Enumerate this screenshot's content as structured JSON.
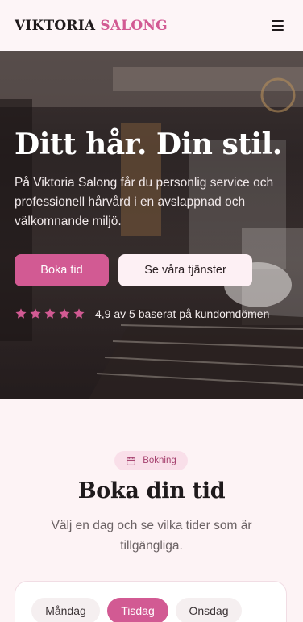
{
  "header": {
    "logo_part1": "VIKTORIA",
    "logo_part2": "SALONG",
    "menu_icon": "hamburger-menu-icon"
  },
  "hero": {
    "title": "Ditt hår. Din stil.",
    "text": "På Viktoria Salong får du personlig service och professionell hårvård i en avslappnad och välkomnande miljö.",
    "primary_button": "Boka tid",
    "secondary_button": "Se våra tjänster",
    "rating": {
      "stars": 5,
      "max": 5,
      "text": "4,9 av 5 baserat på kundomdömen"
    }
  },
  "booking": {
    "badge": "Bokning",
    "badge_icon": "calendar-icon",
    "title": "Boka din tid",
    "subtitle": "Välj en dag och se vilka tider som är tillgängliga.",
    "days": [
      {
        "label": "Måndag",
        "active": false
      },
      {
        "label": "Tisdag",
        "active": true
      },
      {
        "label": "Onsdag",
        "active": false
      }
    ]
  },
  "colors": {
    "accent": "#d25a93",
    "background": "#fdf3f5",
    "text": "#1f1a1c",
    "star": "#d25a93"
  }
}
